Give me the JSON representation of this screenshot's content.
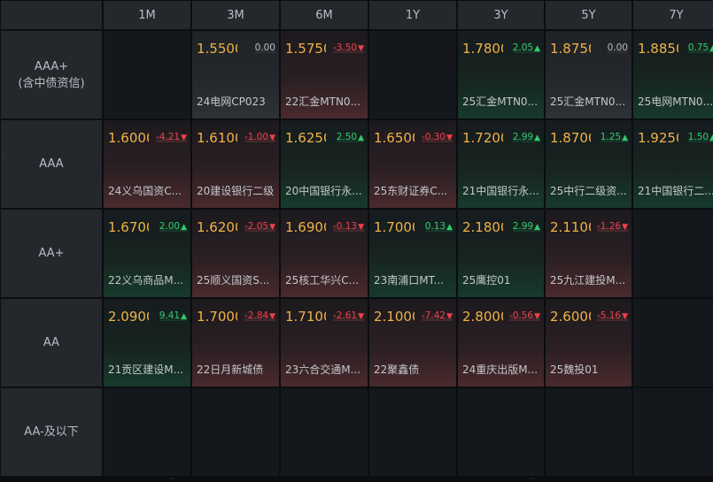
{
  "columns": [
    "1M",
    "3M",
    "6M",
    "1Y",
    "3Y",
    "5Y",
    "7Y"
  ],
  "rows": [
    {
      "label": "AAA+",
      "sublabel": "(含中债资信)",
      "cells": [
        null,
        {
          "rate": "1.5500",
          "change": "0.00",
          "direction": "flat",
          "name": "24电网CP023"
        },
        {
          "rate": "1.5750",
          "change": "-3.50",
          "direction": "down",
          "name": "22汇金MTN0..."
        },
        null,
        {
          "rate": "1.7800",
          "change": "2.05",
          "direction": "up",
          "name": "25汇金MTN0..."
        },
        {
          "rate": "1.8750",
          "change": "0.00",
          "direction": "flat",
          "name": "25汇金MTN0..."
        },
        {
          "rate": "1.8850",
          "change": "0.75",
          "direction": "up",
          "name": "25电网MTN0..."
        }
      ]
    },
    {
      "label": "AAA",
      "sublabel": "",
      "cells": [
        {
          "rate": "1.6000",
          "change": "-4.21",
          "direction": "down",
          "name": "24义乌国资C..."
        },
        {
          "rate": "1.6100",
          "change": "-1.00",
          "direction": "down",
          "name": "20建设银行二级"
        },
        {
          "rate": "1.6250",
          "change": "2.50",
          "direction": "up",
          "name": "20中国银行永..."
        },
        {
          "rate": "1.6500",
          "change": "-0.30",
          "direction": "down",
          "name": "25东财证券C..."
        },
        {
          "rate": "1.7200",
          "change": "2.99",
          "direction": "up",
          "name": "21中国银行永..."
        },
        {
          "rate": "1.8700",
          "change": "1.25",
          "direction": "up",
          "name": "25中行二级资..."
        },
        {
          "rate": "1.9250",
          "change": "1.50",
          "direction": "up",
          "name": "21中国银行二..."
        }
      ]
    },
    {
      "label": "AA+",
      "sublabel": "",
      "cells": [
        {
          "rate": "1.6700",
          "change": "2.00",
          "direction": "up",
          "name": "22义乌商品M..."
        },
        {
          "rate": "1.6200",
          "change": "-2.05",
          "direction": "down",
          "name": "25顺义国资S..."
        },
        {
          "rate": "1.6900",
          "change": "-0.13",
          "direction": "down",
          "name": "25核工华兴C..."
        },
        {
          "rate": "1.7000",
          "change": "0.13",
          "direction": "up",
          "name": "23南浦口MT..."
        },
        {
          "rate": "2.1800",
          "change": "2.99",
          "direction": "up",
          "name": "25鹰控01"
        },
        {
          "rate": "2.1100",
          "change": "-1.26",
          "direction": "down",
          "name": "25九江建投M..."
        },
        null
      ]
    },
    {
      "label": "AA",
      "sublabel": "",
      "cells": [
        {
          "rate": "2.0900",
          "change": "9.41",
          "direction": "up",
          "name": "21贡区建设M..."
        },
        {
          "rate": "1.7000",
          "change": "-2.84",
          "direction": "down",
          "name": "22日月新城债"
        },
        {
          "rate": "1.7100",
          "change": "-2.61",
          "direction": "down",
          "name": "23六合交通M..."
        },
        {
          "rate": "2.1000",
          "change": "-7.42",
          "direction": "down",
          "name": "22聚鑫债"
        },
        {
          "rate": "2.8000",
          "change": "-0.56",
          "direction": "down",
          "name": "24重庆出版M..."
        },
        {
          "rate": "2.6000",
          "change": "-5.16",
          "direction": "down",
          "name": "25魏投01"
        },
        null
      ]
    },
    {
      "label": "AA-及以下",
      "sublabel": "",
      "cells": [
        null,
        null,
        null,
        null,
        null,
        null,
        null
      ]
    }
  ],
  "icons": {
    "up": "▲",
    "down": "▼",
    "flat": ""
  },
  "colors": {
    "up": "#2fcd6f",
    "down": "#f0404a",
    "rate": "#f0b248",
    "background": "#0b0d10"
  }
}
